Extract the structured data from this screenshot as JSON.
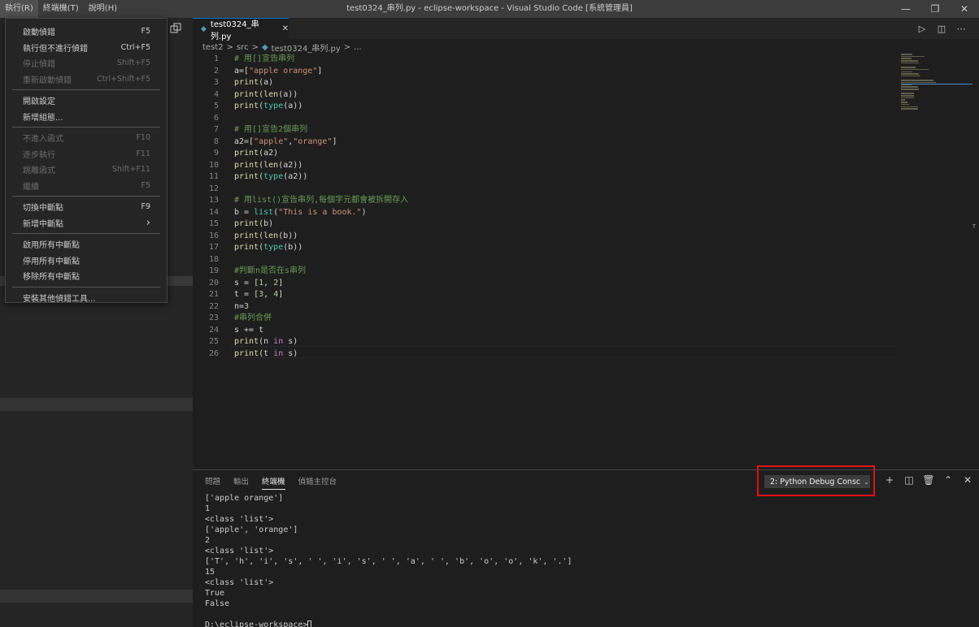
{
  "menubar": {
    "items": [
      "執行(R)",
      "終端機(T)",
      "說明(H)"
    ]
  },
  "window_title": "test0324_串列.py - eclipse-workspace - Visual Studio Code [系統管理員]",
  "run_menu": {
    "items": [
      {
        "label": "啟動偵錯",
        "shortcut": "F5",
        "disabled": false
      },
      {
        "label": "執行但不進行偵錯",
        "shortcut": "Ctrl+F5",
        "disabled": false
      },
      {
        "label": "停止偵錯",
        "shortcut": "Shift+F5",
        "disabled": true
      },
      {
        "label": "重新啟動偵錯",
        "shortcut": "Ctrl+Shift+F5",
        "disabled": true
      },
      {
        "label": "開啟設定",
        "shortcut": "",
        "disabled": false
      },
      {
        "label": "新增組態...",
        "shortcut": "",
        "disabled": false
      },
      {
        "label": "不進入函式",
        "shortcut": "F10",
        "disabled": true
      },
      {
        "label": "逐步執行",
        "shortcut": "F11",
        "disabled": true
      },
      {
        "label": "跳離函式",
        "shortcut": "Shift+F11",
        "disabled": true
      },
      {
        "label": "繼續",
        "shortcut": "F5",
        "disabled": true
      },
      {
        "label": "切換中斷點",
        "shortcut": "F9",
        "disabled": false
      },
      {
        "label": "新增中斷點",
        "shortcut": "›",
        "disabled": false
      },
      {
        "label": "啟用所有中斷點",
        "shortcut": "",
        "disabled": false
      },
      {
        "label": "停用所有中斷點",
        "shortcut": "",
        "disabled": false
      },
      {
        "label": "移除所有中斷點",
        "shortcut": "",
        "disabled": false
      },
      {
        "label": "安裝其他偵錯工具...",
        "shortcut": "",
        "disabled": false
      }
    ]
  },
  "editor": {
    "tab_label": "test0324_串列.py",
    "breadcrumb": [
      "test2",
      ">",
      "src",
      ">",
      "test0324_串列.py",
      ">",
      "..."
    ]
  },
  "code_lines": [
    {
      "n": "1",
      "t": "# 用[]宣告串列"
    },
    {
      "n": "2",
      "t": "a=[\"apple orange\"]"
    },
    {
      "n": "3",
      "t": "print(a)"
    },
    {
      "n": "4",
      "t": "print(len(a))"
    },
    {
      "n": "5",
      "t": "print(type(a))"
    },
    {
      "n": "6",
      "t": ""
    },
    {
      "n": "7",
      "t": "# 用[]宣告2個串列"
    },
    {
      "n": "8",
      "t": "a2=[\"apple\",\"orange\"]"
    },
    {
      "n": "9",
      "t": "print(a2)"
    },
    {
      "n": "10",
      "t": "print(len(a2))"
    },
    {
      "n": "11",
      "t": "print(type(a2))"
    },
    {
      "n": "12",
      "t": ""
    },
    {
      "n": "13",
      "t": "# 用list()宣告串列,每個字元都會被拆開存入"
    },
    {
      "n": "14",
      "t": "b = list(\"This is a book.\")"
    },
    {
      "n": "15",
      "t": "print(b)"
    },
    {
      "n": "16",
      "t": "print(len(b))"
    },
    {
      "n": "17",
      "t": "print(type(b))"
    },
    {
      "n": "18",
      "t": ""
    },
    {
      "n": "19",
      "t": "#判斷n是否在s串列"
    },
    {
      "n": "20",
      "t": "s = [1, 2]"
    },
    {
      "n": "21",
      "t": "t = [3, 4]"
    },
    {
      "n": "22",
      "t": "n=3"
    },
    {
      "n": "23",
      "t": "#串列合併"
    },
    {
      "n": "24",
      "t": "s += t"
    },
    {
      "n": "25",
      "t": "print(n in s)"
    },
    {
      "n": "26",
      "t": "print(t in s)"
    }
  ],
  "panel": {
    "tabs": [
      "問題",
      "輸出",
      "終端機",
      "偵錯主控台"
    ],
    "active_tab": "終端機",
    "terminal_select": "2: Python Debug Consc",
    "output": [
      "['apple orange']",
      "1",
      "<class 'list'>",
      "['apple', 'orange']",
      "2",
      "<class 'list'>",
      "['T', 'h', 'i', 's', ' ', 'i', 's', ' ', 'a', ' ', 'b', 'o', 'o', 'k', '.']",
      "15",
      "<class 'list'>",
      "True",
      "False",
      ""
    ],
    "prompt": "D:\\eclipse-workspace>"
  },
  "colors": {
    "accent": "#007acc",
    "highlight_box": "#e01010"
  }
}
